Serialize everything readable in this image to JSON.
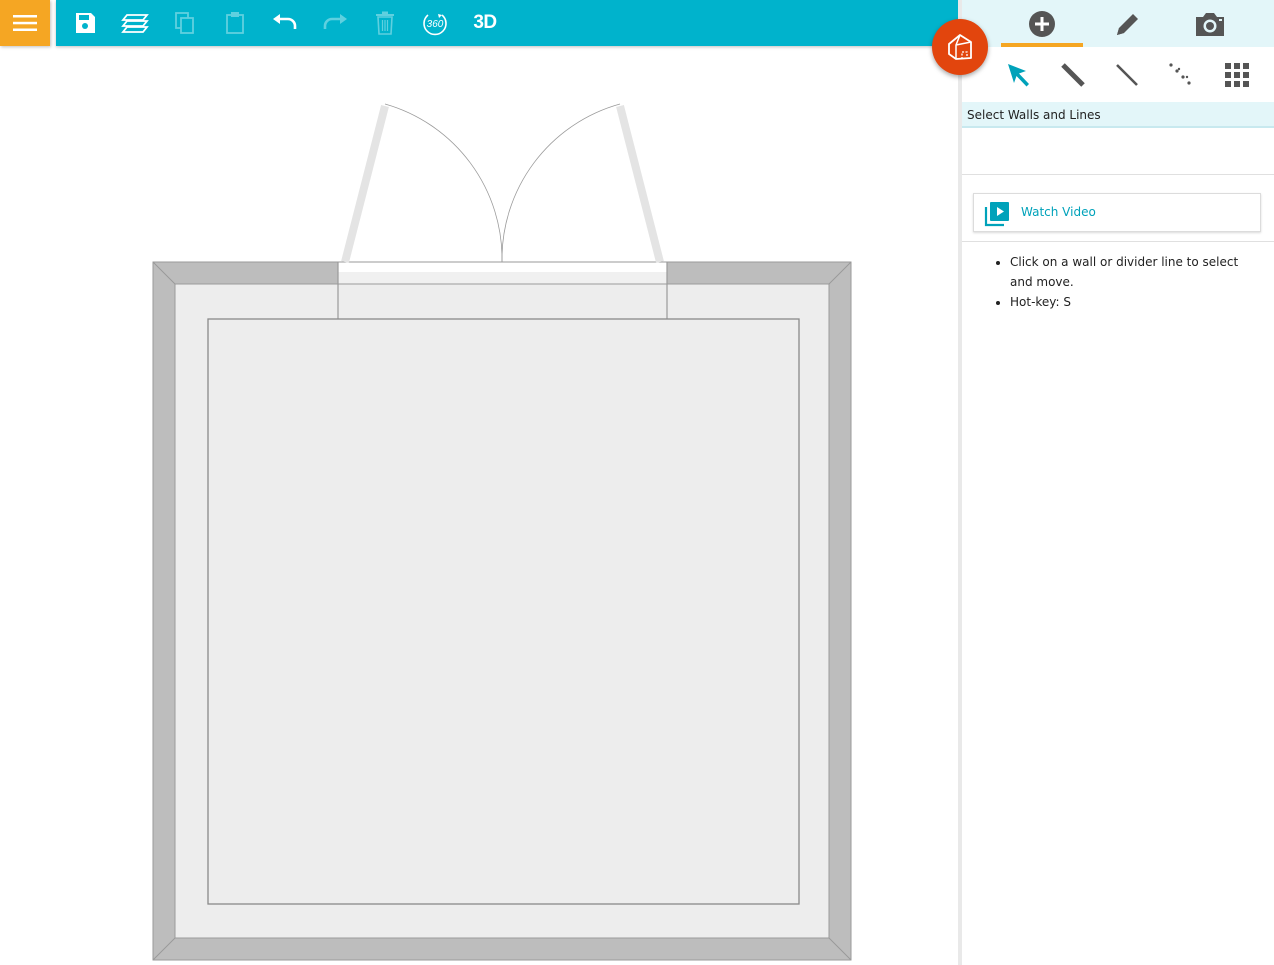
{
  "colors": {
    "accent": "#00b3cc",
    "menu": "#f5a623",
    "fab": "#e2450d",
    "tab_underline": "#f5a623",
    "panel_header_bg": "#e3f6f9",
    "link": "#00a2ba",
    "wall_fill": "#bdbdbd",
    "floor_fill": "#ededed"
  },
  "toolbar": {
    "menu_icon": "hamburger-icon",
    "buttons": [
      {
        "icon": "save-icon",
        "enabled": true
      },
      {
        "icon": "layers-icon",
        "enabled": true
      },
      {
        "icon": "copy-icon",
        "enabled": false
      },
      {
        "icon": "paste-icon",
        "enabled": false
      },
      {
        "icon": "undo-icon",
        "enabled": true
      },
      {
        "icon": "redo-icon",
        "enabled": false
      },
      {
        "icon": "delete-icon",
        "enabled": false
      },
      {
        "icon": "360-view-icon",
        "label": "360",
        "enabled": true
      }
    ],
    "label_3d": "3D"
  },
  "fab": {
    "icon": "house-3d-icon"
  },
  "panel": {
    "tabs": [
      {
        "icon": "add-icon",
        "active": true
      },
      {
        "icon": "pencil-icon",
        "active": false
      },
      {
        "icon": "camera-icon",
        "active": false
      }
    ],
    "tools": [
      {
        "icon": "select-arrow-icon",
        "active": true
      },
      {
        "icon": "wall-tool-icon",
        "active": false
      },
      {
        "icon": "line-tool-icon",
        "active": false
      },
      {
        "icon": "dotted-line-icon",
        "active": false
      },
      {
        "icon": "grid-icon",
        "active": false
      }
    ],
    "mode_title": "Select Walls and Lines",
    "video_button": {
      "icon": "video-library-icon",
      "label": "Watch Video"
    },
    "help_items": [
      "Click on a wall or divider line to select and move.",
      "Hot-key: S"
    ]
  }
}
